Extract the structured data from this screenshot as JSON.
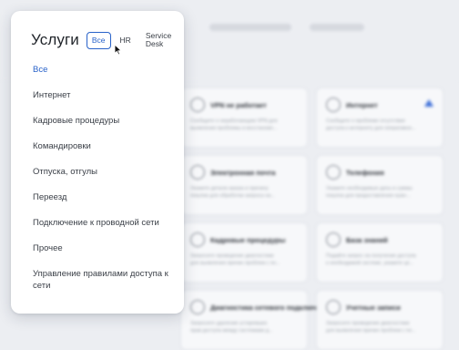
{
  "background": {
    "cards": [
      {
        "title": "VPN не работает",
        "desc": [
          "Сообщите о неработающем VPN для",
          "выявления проблемы и восстановл..."
        ],
        "icon": "vpn-icon",
        "accent": false
      },
      {
        "title": "Интернет",
        "desc": [
          "Сообщите о проблеме отсутствия",
          "доступа к интернету для оперативно..."
        ],
        "icon": "antenna-icon",
        "accent": true
      },
      {
        "title": "Электронная почта",
        "desc": [
          "Укажите детали заказа и причину",
          "покупки для обработки запроса на..."
        ],
        "icon": "mail-icon",
        "accent": false
      },
      {
        "title": "Телефония",
        "desc": [
          "Укажите необходимые даты и суммы",
          "покупок для предоставления нужн..."
        ],
        "icon": "phone-icon",
        "accent": false
      },
      {
        "title": "Кадровые процедуры",
        "desc": [
          "Запросите проведение диагностики",
          "для выявления причин проблем с по..."
        ],
        "icon": "hr-icon",
        "accent": false
      },
      {
        "title": "База знаний",
        "desc": [
          "Подайте запрос на получение доступа",
          "к необходимой системе, укажите це..."
        ],
        "icon": "book-icon",
        "accent": false
      },
      {
        "title": "Диагностика сетевого подключения",
        "desc": [
          "Запросите удаление устаревших",
          "прав доступа между системами д..."
        ],
        "icon": "network-icon",
        "accent": false
      },
      {
        "title": "Учетные записи",
        "desc": [
          "Запросите проведение диагностики",
          "для выявления причин проблем с по..."
        ],
        "icon": "user-icon",
        "accent": false
      }
    ]
  },
  "popup": {
    "title": "Услуги",
    "tabs": [
      {
        "label": "Все",
        "active": true
      },
      {
        "label": "HR",
        "active": false
      },
      {
        "label": "Service Desk",
        "active": false
      }
    ],
    "menu": [
      {
        "label": "Все",
        "active": true
      },
      {
        "label": "Интернет",
        "active": false
      },
      {
        "label": "Кадровые процедуры",
        "active": false
      },
      {
        "label": "Командировки",
        "active": false
      },
      {
        "label": "Отпуска, отгулы",
        "active": false
      },
      {
        "label": "Переезд",
        "active": false
      },
      {
        "label": "Подключение к проводной сети",
        "active": false
      },
      {
        "label": "Прочее",
        "active": false
      },
      {
        "label": "Управление правилами доступа к сети",
        "active": false
      }
    ]
  },
  "colors": {
    "accent": "#2862c9",
    "text": "#3a3f47",
    "background": "#eceef2"
  }
}
